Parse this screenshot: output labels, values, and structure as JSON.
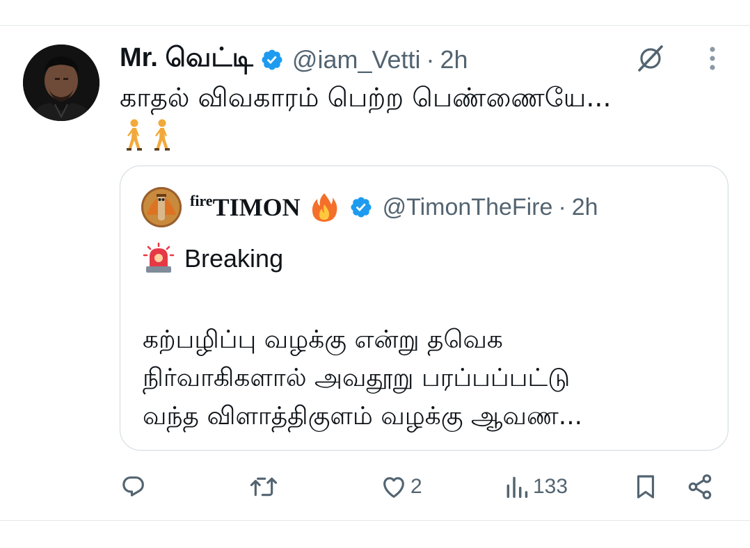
{
  "tweet": {
    "display_name": "Mr. வெட்டி",
    "handle": "@iam_Vetti",
    "separator": "·",
    "time": "2h",
    "text": "காதல் விவகாரம் பெற்ற பெண்ணையே...",
    "emojis": [
      "🚶",
      "🚶"
    ],
    "icons": {
      "avatar": "avatar-photo",
      "verified": "verified-badge-icon",
      "grok": "grok-icon",
      "more": "more-options-icon"
    }
  },
  "quote": {
    "name_superscript": "fire",
    "name_main": "TIMON",
    "name_emoji": "fire-emoji",
    "handle": "@TimonTheFire",
    "separator": "·",
    "time": "2h",
    "siren_emoji": "siren-emoji",
    "breaking_label": "Breaking",
    "body_lines": [
      "கற்பழிப்பு வழக்கு என்று தவெக",
      "நிர்வாகிகளால் அவதூறு பரப்பப்பட்டு",
      "வந்த விளாத்திகுளம் வழக்கு ஆவண..."
    ]
  },
  "actions": {
    "reply": {
      "icon": "reply-icon",
      "count": ""
    },
    "repost": {
      "icon": "repost-icon",
      "count": ""
    },
    "like": {
      "icon": "like-icon",
      "count": "2"
    },
    "views": {
      "icon": "views-icon",
      "count": "133"
    },
    "bookmark": {
      "icon": "bookmark-icon"
    },
    "share": {
      "icon": "share-icon"
    }
  },
  "colors": {
    "text_primary": "#0f1419",
    "text_secondary": "#536471",
    "verified_blue": "#1d9bf0",
    "border": "#cfd9de"
  }
}
